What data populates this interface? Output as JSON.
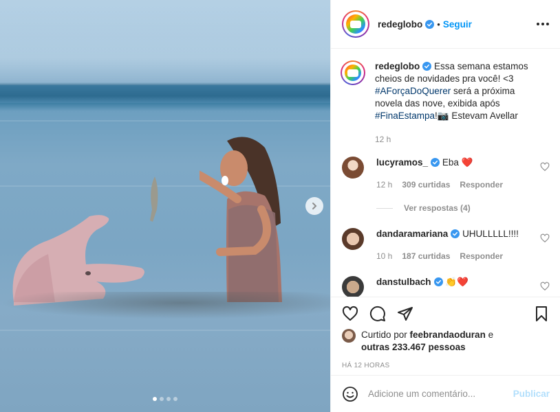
{
  "post": {
    "username": "redeglobo",
    "follow_label": "Seguir",
    "separator": "•",
    "more_icon": "more-options-icon",
    "carousel": {
      "total_slides": 4,
      "active_index": 0,
      "next_icon": "chevron-right-icon"
    }
  },
  "caption": {
    "username": "redeglobo",
    "text_a": "Essa semana estamos cheios de novidades pra você! <3",
    "hashtag_1": "#AForçaDoQuerer",
    "text_b": " será a próxima novela das nove, exibida após ",
    "hashtag_2": "#FinaEstampa",
    "text_c": "!📷 Estevam Avellar",
    "time": "12 h"
  },
  "comments": [
    {
      "username": "lucyramos_",
      "text": "Eba",
      "emoji": "❤️",
      "time": "12 h",
      "likes": "309 curtidas",
      "reply_label": "Responder",
      "view_replies": "Ver respostas (4)"
    },
    {
      "username": "dandaramariana",
      "text": "UHULLLLL!!!!",
      "time": "10 h",
      "likes": "187 curtidas",
      "reply_label": "Responder"
    },
    {
      "username": "danstulbach",
      "emoji": "👏❤️"
    }
  ],
  "actions": {
    "liked_by_prefix": "Curtido por ",
    "liked_by_user": "feebrandaoduran",
    "liked_by_joiner": " e",
    "others": "outras 233.467 pessoas",
    "time_ago": "HÁ 12 HORAS"
  },
  "add_comment": {
    "placeholder": "Adicione um comentário...",
    "publish_label": "Publicar"
  },
  "colors": {
    "accent": "#0095f6",
    "verified": "#3897f0",
    "hashtag": "#00376b",
    "muted": "#8e8e8e",
    "publish_disabled": "#b2dffc"
  }
}
